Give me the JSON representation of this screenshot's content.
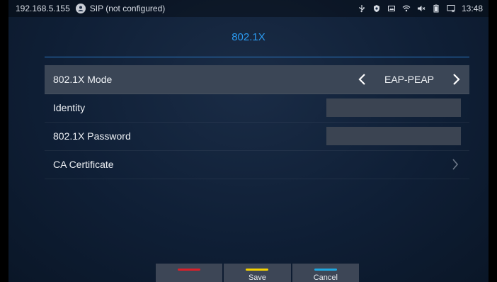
{
  "statusbar": {
    "ip": "192.168.5.155",
    "sip_status": "SIP (not configured)",
    "time": "13:48",
    "icons": [
      "usb-icon",
      "shield-icon",
      "screenshot-icon",
      "wifi-icon",
      "mute-icon",
      "battery-icon",
      "missed-call-icon"
    ]
  },
  "page": {
    "title": "802.1X"
  },
  "settings": {
    "mode": {
      "label": "802.1X Mode",
      "value": "EAP-PEAP"
    },
    "identity": {
      "label": "Identity",
      "value": ""
    },
    "password": {
      "label": "802.1X Password",
      "value": ""
    },
    "ca_certificate": {
      "label": "CA Certificate"
    }
  },
  "softkeys": [
    {
      "label": "",
      "color": "#d9202a"
    },
    {
      "label": "Save",
      "color": "#f5d200"
    },
    {
      "label": "Cancel",
      "color": "#1ea7e0"
    }
  ],
  "colors": {
    "accent": "#2b9bf0",
    "selected_row": "#3b4656",
    "background": "#0f1f36"
  }
}
